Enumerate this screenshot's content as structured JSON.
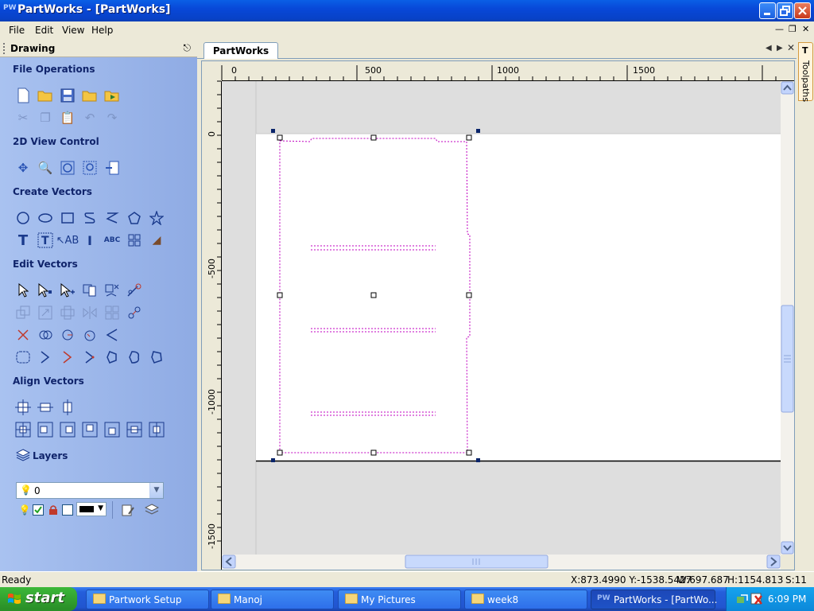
{
  "window": {
    "title": "PartWorks - [PartWorks]",
    "app_icon": "PW",
    "colors": {
      "titlebar": "#0A5FE6",
      "panel": "#99B4E8",
      "selection": "#C000C0"
    }
  },
  "menu": [
    {
      "label": "File"
    },
    {
      "label": "Edit"
    },
    {
      "label": "View"
    },
    {
      "label": "Help"
    }
  ],
  "panel": {
    "title": "Drawing",
    "sections": {
      "file_ops": "File Operations",
      "view_control": "2D View Control",
      "create_vectors": "Create Vectors",
      "edit_vectors": "Edit Vectors",
      "align_vectors": "Align Vectors",
      "layers": "Layers"
    },
    "layer_value": "0"
  },
  "document": {
    "tab": "PartWorks",
    "h_ruler_labels": [
      "0",
      "500",
      "1000",
      "1500"
    ],
    "v_ruler_labels": [
      "0",
      "-500",
      "-1000",
      "-1500"
    ]
  },
  "right_tab": {
    "label": "Toolpaths"
  },
  "status": {
    "ready": "Ready",
    "coords": "X:873.4990 Y:-1538.5427",
    "width": "W:697.687",
    "height": "H:1154.813",
    "selection": "S:11"
  },
  "taskbar": {
    "start": "start",
    "items": [
      {
        "label": "Partwork Setup",
        "icon": "folder-icon"
      },
      {
        "label": "Manoj",
        "icon": "folder-icon"
      },
      {
        "label": "My Pictures",
        "icon": "folder-icon"
      },
      {
        "label": "week8",
        "icon": "folder-icon"
      },
      {
        "label": "PartWorks - [PartWo...",
        "icon": "partworks-icon"
      }
    ],
    "clock": "6:09 PM"
  }
}
